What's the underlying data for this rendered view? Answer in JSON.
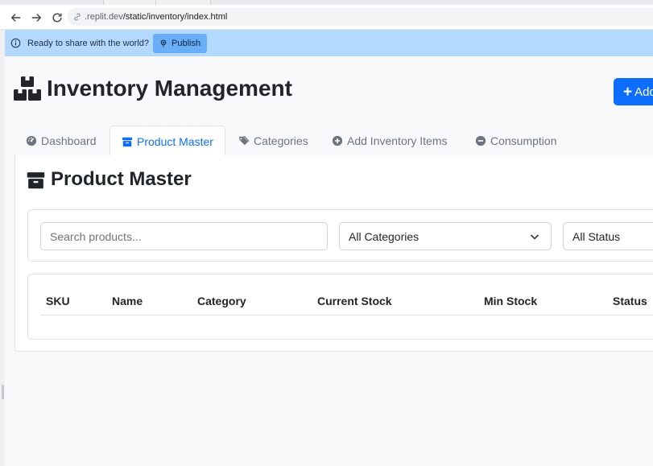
{
  "browser": {
    "url_host": ".replit.dev",
    "url_path": "/static/inventory/index.html"
  },
  "infobar": {
    "message": "Ready to share with the world?",
    "publish_label": "Publish"
  },
  "app": {
    "title": "Inventory Management",
    "add_button_label": "Add"
  },
  "tabs": [
    {
      "label": "Dashboard",
      "icon": "dashboard-icon",
      "active": false
    },
    {
      "label": "Product Master",
      "icon": "box-icon",
      "active": true
    },
    {
      "label": "Categories",
      "icon": "tags-icon",
      "active": false
    },
    {
      "label": "Add Inventory Items",
      "icon": "plus-circle-icon",
      "active": false
    },
    {
      "label": "Consumption",
      "icon": "minus-circle-icon",
      "active": false
    }
  ],
  "panel": {
    "title": "Product Master"
  },
  "filters": {
    "search_placeholder": "Search products...",
    "category_selected": "All Categories",
    "status_selected": "All Status"
  },
  "table": {
    "columns": [
      "SKU",
      "Name",
      "Category",
      "Current Stock",
      "Min Stock",
      "Status"
    ]
  },
  "colors": {
    "primary": "#0d6efd",
    "infobar_bg": "#b3d9ff",
    "publish_bg": "#6aaef7"
  }
}
